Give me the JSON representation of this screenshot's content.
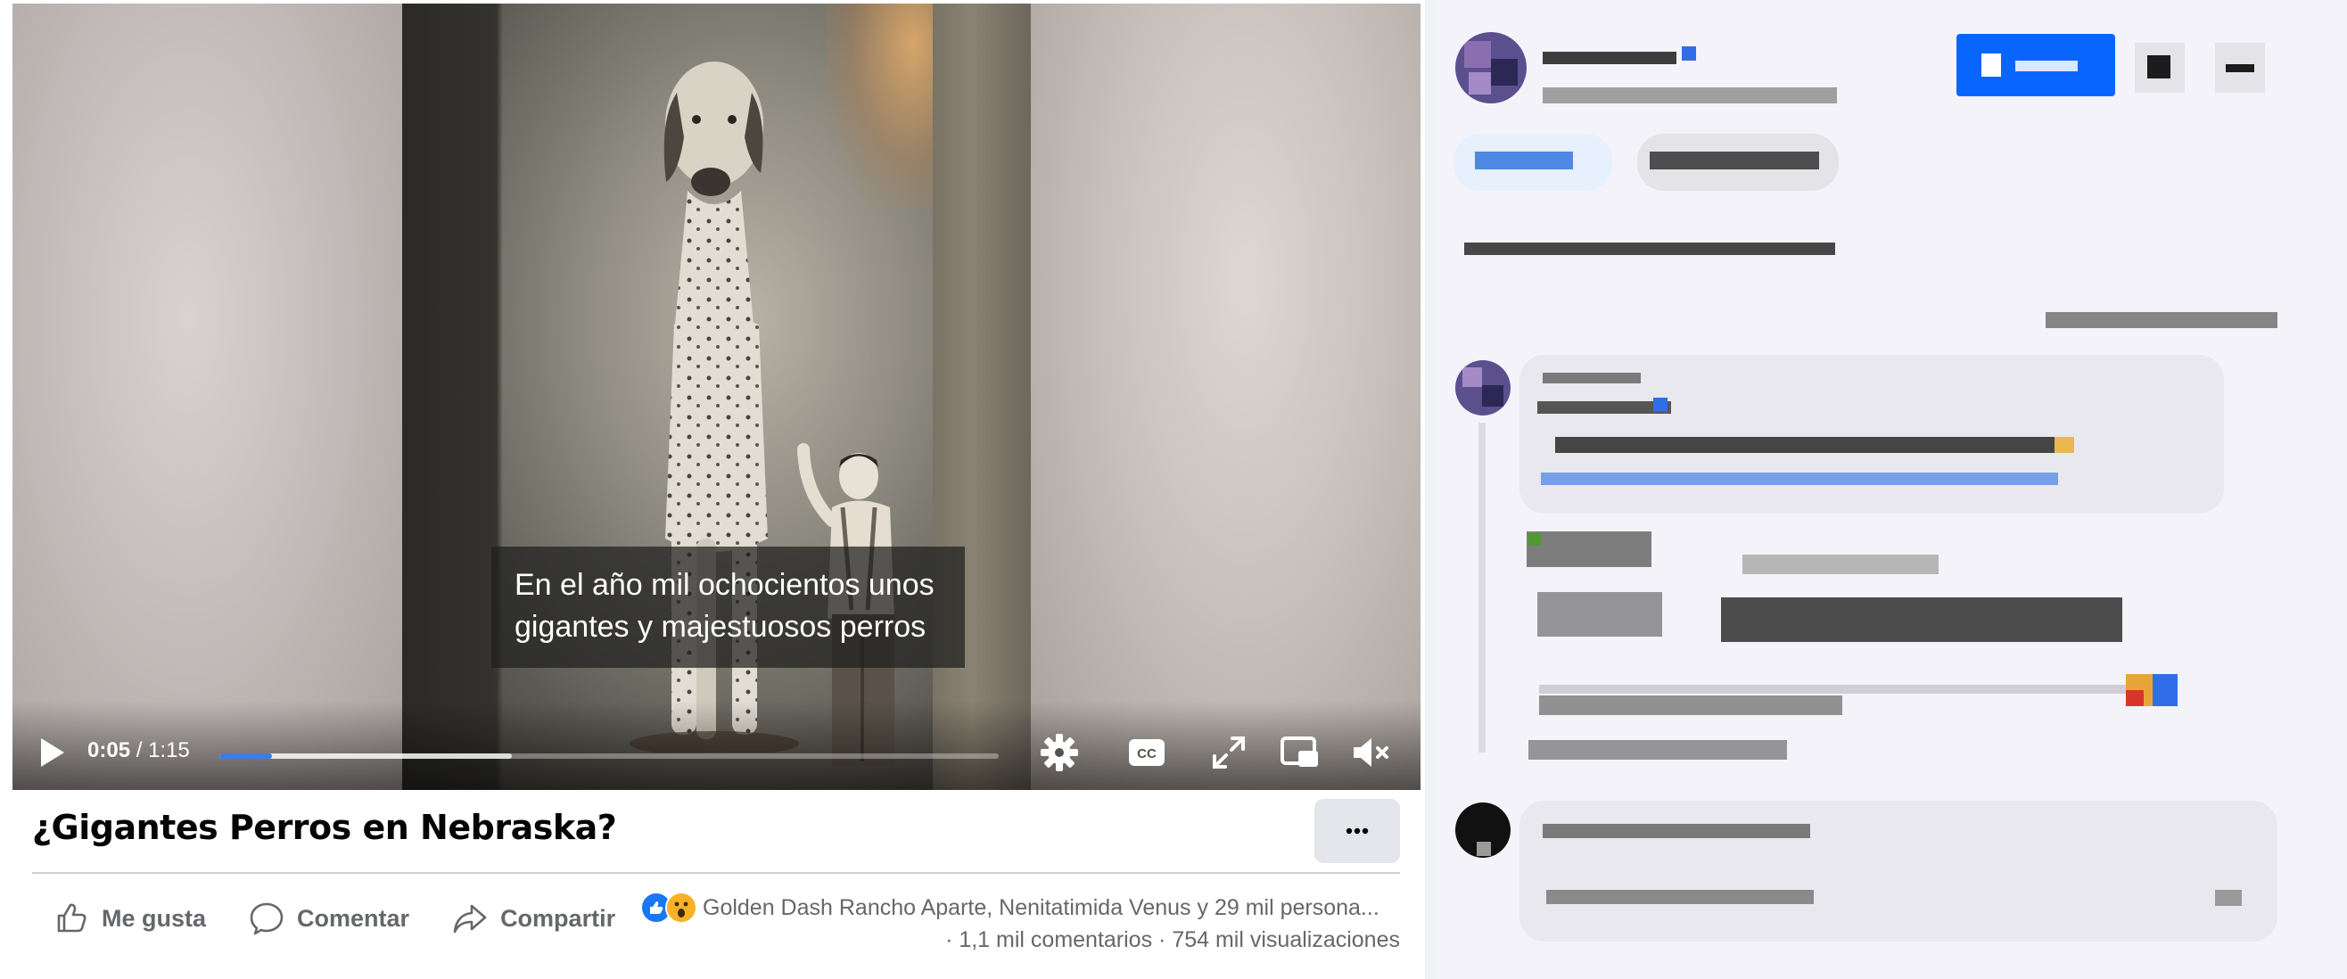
{
  "video": {
    "subtitle_line1": "En el año mil ochocientos unos",
    "subtitle_line2": "gigantes y majestuosos perros",
    "current_time": "0:05",
    "separator": "/",
    "duration": "1:15",
    "played_fraction": 0.067,
    "buffered_fraction": 0.375
  },
  "post": {
    "title": "¿Gigantes Perros en Nebraska?",
    "more_label": "···",
    "actions": {
      "like": "Me gusta",
      "comment": "Comentar",
      "share": "Compartir"
    },
    "reactions_text": "Golden Dash Rancho Aparte, Nenitatimida Venus y 29 mil persona...",
    "comments_count": "· 1,1 mil comentarios",
    "views_count": "· 754 mil visualizaciones"
  },
  "colors": {
    "brand_blue": "#1877f2",
    "progress_blue": "#3b7bea",
    "wow_yellow": "#f7b125"
  },
  "icons": {
    "play": "play-icon",
    "settings": "gear-icon",
    "captions": "cc-icon",
    "fullscreen": "expand-icon",
    "pip": "picture-in-picture-icon",
    "mute": "muted-speaker-icon",
    "like": "thumbs-up-icon",
    "comment": "speech-bubble-icon",
    "share": "share-arrow-icon"
  }
}
